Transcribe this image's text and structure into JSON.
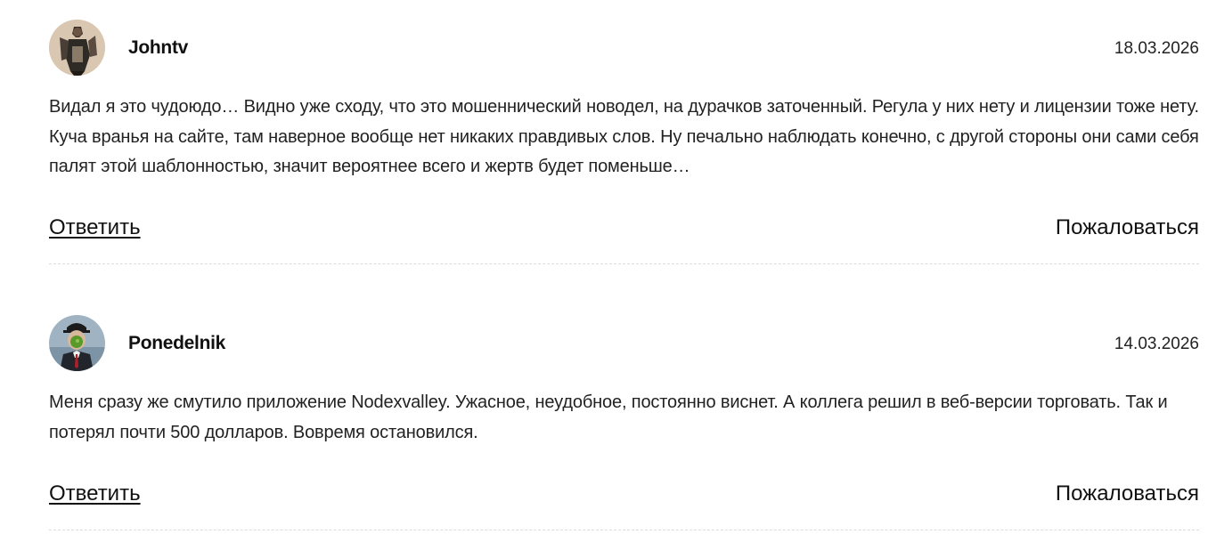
{
  "comments": [
    {
      "author": "Johntv",
      "date": "18.03.2026",
      "avatar_icon": "person-photo-avatar-icon",
      "text": "Видал я это чудоюдо… Видно уже сходу, что это мошеннический новодел, на дурачков заточенный. Регула у них нету и лицензии тоже нету. Куча вранья на сайте, там наверное вообще нет никаких правдивых слов. Ну печально наблюдать конечно, с другой стороны они сами себя палят этой шаблонностью, значит вероятнее всего и жертв будет поменьше…",
      "reply_label": "Ответить",
      "report_label": "Пожаловаться"
    },
    {
      "author": "Ponedelnik",
      "date": "14.03.2026",
      "avatar_icon": "son-of-man-avatar-icon",
      "text": "Меня сразу же смутило приложение Nodexvalley. Ужасное, неудобное, постоянно виснет. А коллега решил в веб-версии торговать. Так и потерял почти 500 долларов. Вовремя остановился.",
      "reply_label": "Ответить",
      "report_label": "Пожаловаться"
    }
  ],
  "colors": {
    "text": "#222222",
    "author": "#111111",
    "divider": "#dcdcdc",
    "background": "#ffffff"
  }
}
